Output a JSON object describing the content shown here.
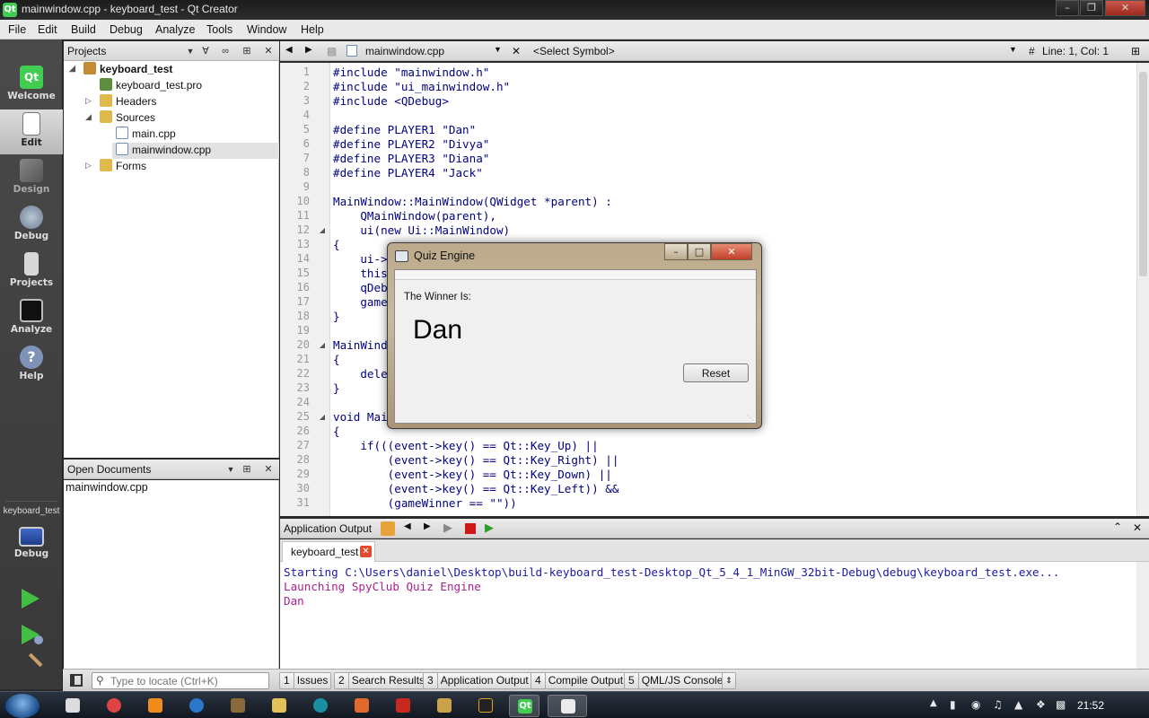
{
  "window": {
    "title": "mainwindow.cpp - keyboard_test - Qt Creator",
    "logo": "Qt"
  },
  "menu": [
    "File",
    "Edit",
    "Build",
    "Debug",
    "Analyze",
    "Tools",
    "Window",
    "Help"
  ],
  "modes": [
    {
      "label": "Welcome",
      "icon": "qt-logo-icon"
    },
    {
      "label": "Edit",
      "icon": "edit-document-icon"
    },
    {
      "label": "Design",
      "icon": "design-pencil-icon"
    },
    {
      "label": "Debug",
      "icon": "debug-bug-icon"
    },
    {
      "label": "Projects",
      "icon": "projects-icon"
    },
    {
      "label": "Analyze",
      "icon": "analyze-icon"
    },
    {
      "label": "Help",
      "icon": "help-icon"
    }
  ],
  "kit": {
    "project": "keyboard_test",
    "config": "Debug"
  },
  "projects_pane": {
    "title": "Projects",
    "tree": [
      {
        "label": "keyboard_test",
        "depth": 0,
        "bold": true
      },
      {
        "label": "keyboard_test.pro",
        "depth": 1
      },
      {
        "label": "Headers",
        "depth": 1
      },
      {
        "label": "Sources",
        "depth": 1
      },
      {
        "label": "main.cpp",
        "depth": 2
      },
      {
        "label": "mainwindow.cpp",
        "depth": 2,
        "selected": true
      },
      {
        "label": "Forms",
        "depth": 1
      }
    ]
  },
  "open_documents": {
    "title": "Open Documents",
    "items": [
      "mainwindow.cpp"
    ]
  },
  "editor": {
    "file_combo": "mainwindow.cpp",
    "symbol_combo": "<Select Symbol>",
    "position": "Line: 1, Col: 1",
    "lines": [
      {
        "n": "1",
        "text": "#include \"mainwindow.h\""
      },
      {
        "n": "2",
        "text": "#include \"ui_mainwindow.h\""
      },
      {
        "n": "3",
        "text": "#include <QDebug>"
      },
      {
        "n": "4",
        "text": ""
      },
      {
        "n": "5",
        "text": "#define PLAYER1 \"Dan\""
      },
      {
        "n": "6",
        "text": "#define PLAYER2 \"Divya\""
      },
      {
        "n": "7",
        "text": "#define PLAYER3 \"Diana\""
      },
      {
        "n": "8",
        "text": "#define PLAYER4 \"Jack\""
      },
      {
        "n": "9",
        "text": ""
      },
      {
        "n": "10",
        "text": "MainWindow::MainWindow(QWidget *parent) :"
      },
      {
        "n": "11",
        "text": "    QMainWindow(parent),"
      },
      {
        "n": "12",
        "text": "    ui(new Ui::MainWindow)"
      },
      {
        "n": "13",
        "text": "{"
      },
      {
        "n": "14",
        "text": "    ui->"
      },
      {
        "n": "15",
        "text": "    this"
      },
      {
        "n": "16",
        "text": "    qDeb"
      },
      {
        "n": "17",
        "text": "    game"
      },
      {
        "n": "18",
        "text": "}"
      },
      {
        "n": "19",
        "text": ""
      },
      {
        "n": "20",
        "text": "MainWindo"
      },
      {
        "n": "21",
        "text": "{"
      },
      {
        "n": "22",
        "text": "    dele"
      },
      {
        "n": "23",
        "text": "}"
      },
      {
        "n": "24",
        "text": ""
      },
      {
        "n": "25",
        "text": "void Mai"
      },
      {
        "n": "26",
        "text": "{"
      },
      {
        "n": "27",
        "text": "    if(((event->key() == Qt::Key_Up) ||"
      },
      {
        "n": "28",
        "text": "        (event->key() == Qt::Key_Right) ||"
      },
      {
        "n": "29",
        "text": "        (event->key() == Qt::Key_Down) ||"
      },
      {
        "n": "30",
        "text": "        (event->key() == Qt::Key_Left)) &&"
      },
      {
        "n": "31",
        "text": "        (gameWinner == \"\"))"
      }
    ]
  },
  "output": {
    "title": "Application Output",
    "tab_label": "keyboard_test",
    "lines": [
      {
        "text": "Starting C:\\Users\\daniel\\Desktop\\build-keyboard_test-Desktop_Qt_5_4_1_MinGW_32bit-Debug\\debug\\keyboard_test.exe...",
        "color": "#1a1aa6"
      },
      {
        "text": "Launching SpyClub Quiz Engine",
        "color": "#aa1f8a"
      },
      {
        "text": "Dan",
        "color": "#aa1f8a"
      }
    ]
  },
  "statusbar": {
    "locate_placeholder": "Type to locate (Ctrl+K)",
    "buttons": [
      {
        "num": "1",
        "label": "Issues"
      },
      {
        "num": "2",
        "label": "Search Results"
      },
      {
        "num": "3",
        "label": "Application Output"
      },
      {
        "num": "4",
        "label": "Compile Output"
      },
      {
        "num": "5",
        "label": "QML/JS Console"
      }
    ]
  },
  "dialog": {
    "title": "Quiz Engine",
    "prompt": "The Winner Is:",
    "winner": "Dan",
    "reset_label": "Reset"
  },
  "taskbar": {
    "clock": "21:52"
  },
  "colors": {
    "accent": "#41cd52",
    "keyword": "#808000",
    "string": "#008000",
    "type": "#800080"
  }
}
